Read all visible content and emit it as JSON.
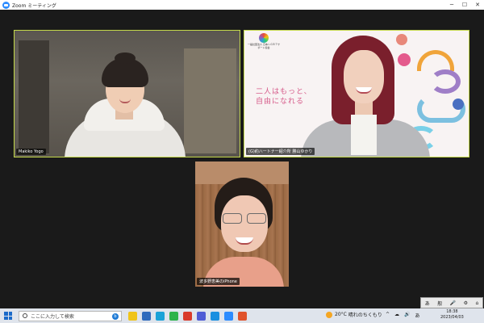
{
  "window": {
    "title": "Zoom ミーティング",
    "minimize": "─",
    "maximize": "☐",
    "close": "✕"
  },
  "participants": [
    {
      "name": "Makiko Yogo",
      "active_speaker": true
    },
    {
      "name": "(G)約ハートナー紹介所 勝山ゆかり",
      "active_speaker": true
    },
    {
      "name": "波多野恵美のiPhone",
      "active_speaker": false
    }
  ],
  "slide": {
    "logo_text": "一般社団法人 日本ＬＧＢＴサポート協会",
    "slogan_line1": "二人はもっと、",
    "slogan_line2": "自由になれる"
  },
  "ime": {
    "items": [
      "あ",
      "般",
      "🎤",
      "⚙",
      "⌂"
    ]
  },
  "taskbar": {
    "search_placeholder": "ここに入力して検索",
    "bing_label": "b",
    "weather_temp": "20°C",
    "weather_desc": "晴れのちくもり",
    "tray": [
      "^",
      "☁",
      "🔊",
      "あ"
    ],
    "time": "18:38",
    "date": "2023/04/03",
    "app_colors": [
      "#f0c419",
      "#2f6bbd",
      "#1aa2d8",
      "#2db34a",
      "#d93a2a",
      "#4f5bd5",
      "#1a8fe0",
      "#2d8cff",
      "#e0532c"
    ]
  }
}
